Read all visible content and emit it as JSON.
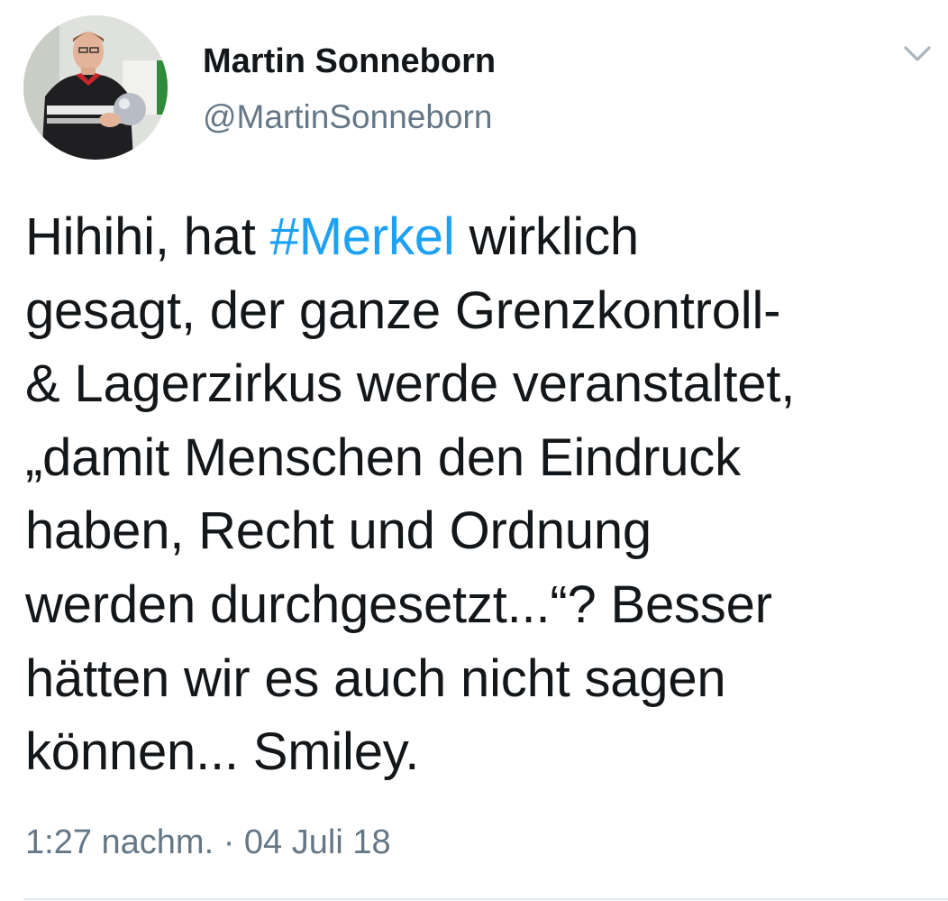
{
  "author": {
    "name": "Martin Sonneborn",
    "handle": "@MartinSonneborn"
  },
  "menu_icon": "chevron-down-icon",
  "tweet": {
    "lines": {
      "l1_before": "Hihihi, hat ",
      "l1_hashtag": "#Merkel",
      "l1_after": " wirklich",
      "l2": "gesagt, der ganze Grenzkontroll-",
      "l3": "& Lagerzirkus werde veranstaltet,",
      "l4": "„damit Menschen den Eindruck",
      "l5": "haben, Recht und Ordnung",
      "l6": "werden durchgesetzt...“? Besser",
      "l7": "hätten wir es auch nicht sagen",
      "l8": "können... Smiley."
    },
    "time": "1:27 nachm.",
    "separator": " · ",
    "date": "04 Juli 18"
  },
  "colors": {
    "text": "#14171a",
    "secondary": "#657786",
    "link": "#1da1f2",
    "divider": "#e1e8ed"
  }
}
